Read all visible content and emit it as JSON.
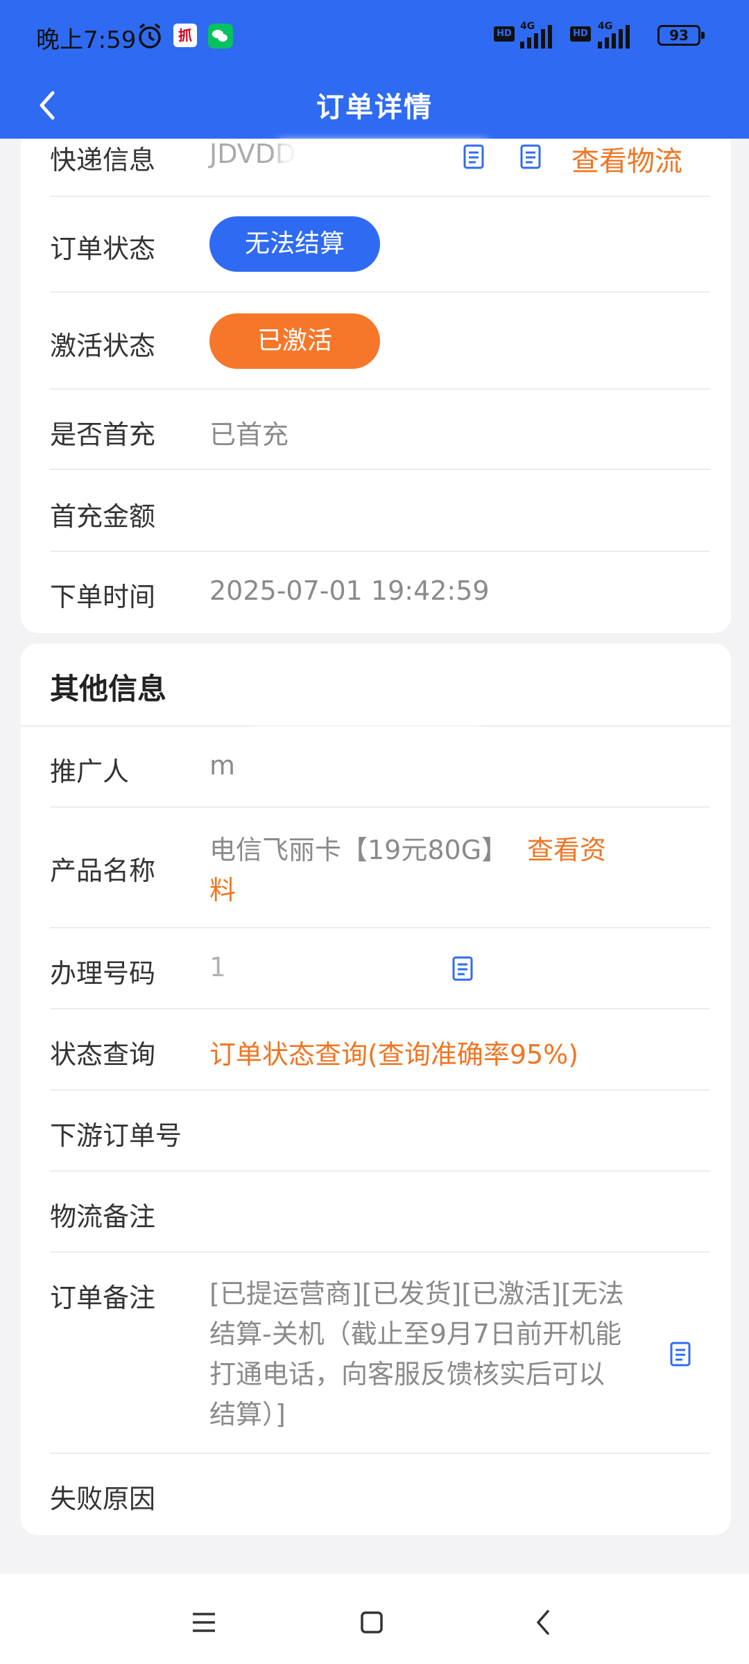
{
  "status": {
    "time": "晚上7:59",
    "app_badge": "抓",
    "hd1": "HD",
    "hd2": "HD",
    "net1": "4G",
    "net2": "4G",
    "battery": "93"
  },
  "nav": {
    "title": "订单详情"
  },
  "order": {
    "express_label": "快递信息",
    "express_value": "JDVDD",
    "express_link": "查看物流",
    "status_label": "订单状态",
    "status_value": "无法结算",
    "activation_label": "激活状态",
    "activation_value": "已激活",
    "first_charge_label": "是否首充",
    "first_charge_value": "已首充",
    "first_amount_label": "首充金额",
    "first_amount_value": "",
    "order_time_label": "下单时间",
    "order_time_value": "2025-07-01 19:42:59"
  },
  "other": {
    "section_title": "其他信息",
    "promoter_label": "推广人",
    "promoter_value": "m",
    "product_label": "产品名称",
    "product_value": "电信飞丽卡【19元80G】",
    "product_link_1": "查看资",
    "product_link_2": "料",
    "number_label": "办理号码",
    "number_value": "1",
    "query_label": "状态查询",
    "query_value": "订单状态查询(查询准确率95%)",
    "downstream_label": "下游订单号",
    "downstream_value": "",
    "logistics_note_label": "物流备注",
    "logistics_note_value": "",
    "order_note_label": "订单备注",
    "order_note_value": "[已提运营商][已发货][已激活][无法结算-关机（截止至9月7日前开机能打通电话，向客服反馈核实后可以结算）]",
    "fail_reason_label": "失败原因",
    "fail_reason_value": ""
  },
  "colors": {
    "primary": "#2f6bf2",
    "accent_orange": "#f07522",
    "text_gray": "#8a8a8a"
  },
  "icons": {
    "back": "back-icon",
    "copy": "copy-icon",
    "menu": "menu-icon",
    "home": "home-icon",
    "system_back": "system-back-icon"
  }
}
